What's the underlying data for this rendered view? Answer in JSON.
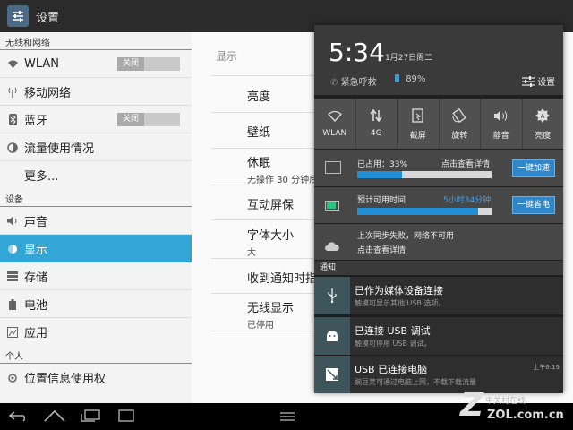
{
  "app": {
    "title": "设置"
  },
  "sidebar": {
    "section_wireless": "无线和网络",
    "wlan": {
      "label": "WLAN",
      "toggle": "关闭"
    },
    "mobile": "移动网络",
    "bluetooth": {
      "label": "蓝牙",
      "toggle": "关闭"
    },
    "data_usage": "流量使用情况",
    "more": "更多...",
    "section_device": "设备",
    "sound": "声音",
    "display": "显示",
    "storage": "存储",
    "battery": "电池",
    "apps": "应用",
    "section_personal": "个人",
    "location": "位置信息使用权"
  },
  "display_settings": {
    "title": "显示",
    "brightness": "亮度",
    "wallpaper": "壁纸",
    "sleep": {
      "label": "休眠",
      "sub": "无操作 30 分钟后"
    },
    "daydream": "互动屏保",
    "font_size": {
      "label": "字体大小",
      "sub": "大"
    },
    "pulse": "收到通知时指",
    "wireless_display": {
      "label": "无线显示",
      "sub": "已停用"
    }
  },
  "shade": {
    "time": "5:34",
    "date": "1月27日周二",
    "emergency": "紧急呼救",
    "battery": "89%",
    "settings": "设置",
    "quick": [
      {
        "label": "WLAN",
        "icon": "wifi-icon"
      },
      {
        "label": "4G",
        "icon": "data-arrows-icon"
      },
      {
        "label": "截屏",
        "icon": "screenshot-icon"
      },
      {
        "label": "旋转",
        "icon": "rotate-icon"
      },
      {
        "label": "静音",
        "icon": "speaker-icon"
      },
      {
        "label": "亮度",
        "icon": "brightness-icon"
      }
    ],
    "memory": {
      "used": "已占用：33%",
      "used_fraction": 0.33,
      "details": "点击查看详情",
      "button": "一键加速"
    },
    "power": {
      "label": "预计可用时间",
      "remaining": "5小时34分钟",
      "fraction": 0.9,
      "button": "一键省电"
    },
    "sync": {
      "line1": "上次同步失败，网络不可用",
      "line2": "点击查看详情"
    },
    "notifications_header": "通知",
    "notifications": [
      {
        "title": "已作为媒体设备连接",
        "sub": "触摸可显示其他 USB 选项。",
        "icon": "usb-icon"
      },
      {
        "title": "已连接 USB 调试",
        "sub": "触摸可停用 USB 调试。",
        "icon": "android-icon"
      },
      {
        "title": "USB 已连接电脑",
        "sub": "豌豆荚可通过电脑上网，不载下载流量",
        "time": "上午6:19",
        "icon": "pc-link-icon"
      }
    ]
  },
  "watermark": {
    "brand": "中关村在线",
    "domain": "ZOL.com.cn"
  }
}
